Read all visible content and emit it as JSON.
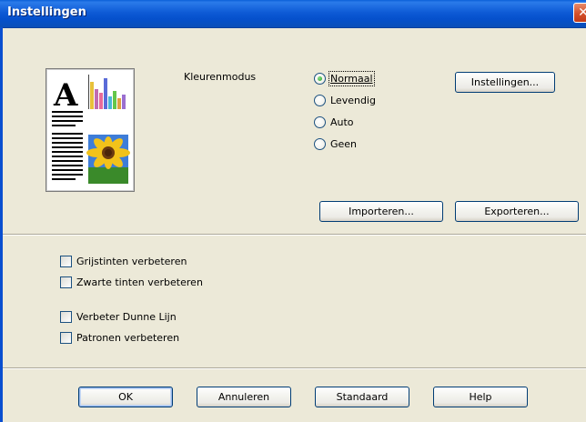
{
  "window": {
    "title": "Instellingen",
    "close_glyph": "✕"
  },
  "color_mode": {
    "label": "Kleurenmodus",
    "options": [
      {
        "label": "Normaal",
        "mnemonic_index": 0,
        "selected": true
      },
      {
        "label": "Levendig",
        "mnemonic_index": 0,
        "selected": false
      },
      {
        "label": "Auto",
        "mnemonic_index": 0,
        "selected": false
      },
      {
        "label": "Geen",
        "mnemonic_index": 0,
        "selected": false
      }
    ]
  },
  "buttons": {
    "settings": "Instellingen...",
    "import": "Importeren...",
    "export": "Exporteren...",
    "ok": "OK",
    "cancel": "Annuleren",
    "default": "Standaard",
    "help": "Help"
  },
  "checkboxes": [
    {
      "label": "Grijstinten verbeteren",
      "checked": false
    },
    {
      "label": "Zwarte tinten verbeteren",
      "checked": false
    },
    {
      "label": "Verbeter Dunne Lijn",
      "checked": false
    },
    {
      "label": "Patronen verbeteren",
      "checked": false
    }
  ],
  "preview": {
    "letter": "A",
    "bar_colors": [
      "#E8C13A",
      "#C06BB0",
      "#E86B9A",
      "#5A6BD8",
      "#49B7D6",
      "#64C64A",
      "#E0A040",
      "#9B6FD0"
    ]
  },
  "colors": {
    "titlebar": "#0A5FD8",
    "dialog_bg": "#ECE9D8",
    "button_border": "#003C74",
    "close_button": "#D4502A"
  }
}
